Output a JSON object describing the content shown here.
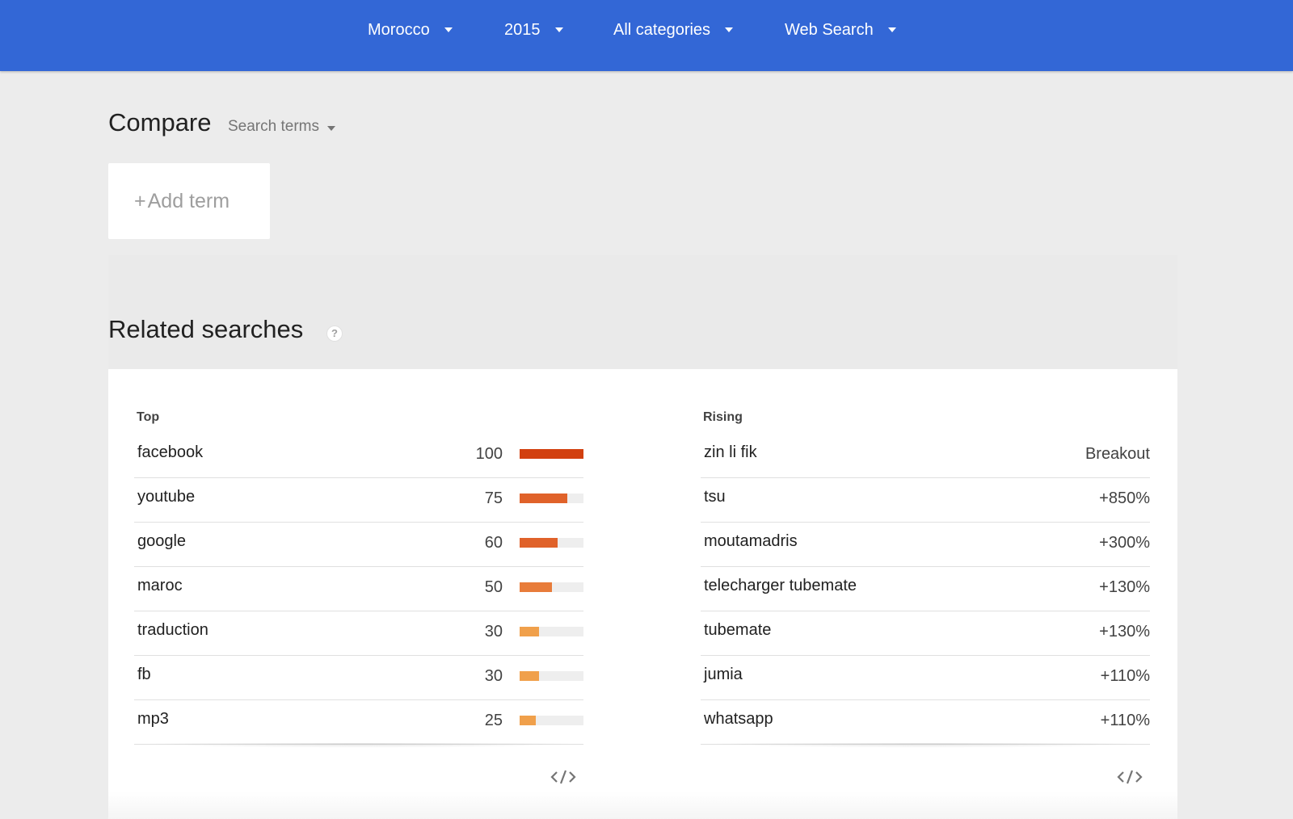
{
  "topbar": {
    "filters": [
      {
        "label": "Morocco"
      },
      {
        "label": "2015"
      },
      {
        "label": "All categories"
      },
      {
        "label": "Web Search"
      }
    ]
  },
  "compare": {
    "title": "Compare",
    "mode": "Search terms",
    "add_term": "Add term"
  },
  "related": {
    "title": "Related searches",
    "help": "?",
    "top": {
      "heading": "Top",
      "rows": [
        {
          "term": "facebook",
          "value": "100",
          "score": 100,
          "color": "#d2400f"
        },
        {
          "term": "youtube",
          "value": "75",
          "score": 75,
          "color": "#e0622a"
        },
        {
          "term": "google",
          "value": "60",
          "score": 60,
          "color": "#e0622a"
        },
        {
          "term": "maroc",
          "value": "50",
          "score": 50,
          "color": "#e87c3a"
        },
        {
          "term": "traduction",
          "value": "30",
          "score": 30,
          "color": "#f0a04b"
        },
        {
          "term": "fb",
          "value": "30",
          "score": 30,
          "color": "#f0a04b"
        },
        {
          "term": "mp3",
          "value": "25",
          "score": 25,
          "color": "#f0a04b"
        }
      ]
    },
    "rising": {
      "heading": "Rising",
      "rows": [
        {
          "term": "zin li fik",
          "value": "Breakout"
        },
        {
          "term": "tsu",
          "value": "+850%"
        },
        {
          "term": "moutamadris",
          "value": "+300%"
        },
        {
          "term": "telecharger tubemate",
          "value": "+130%"
        },
        {
          "term": "tubemate",
          "value": "+130%"
        },
        {
          "term": "jumia",
          "value": "+110%"
        },
        {
          "term": "whatsapp",
          "value": "+110%"
        }
      ]
    }
  }
}
